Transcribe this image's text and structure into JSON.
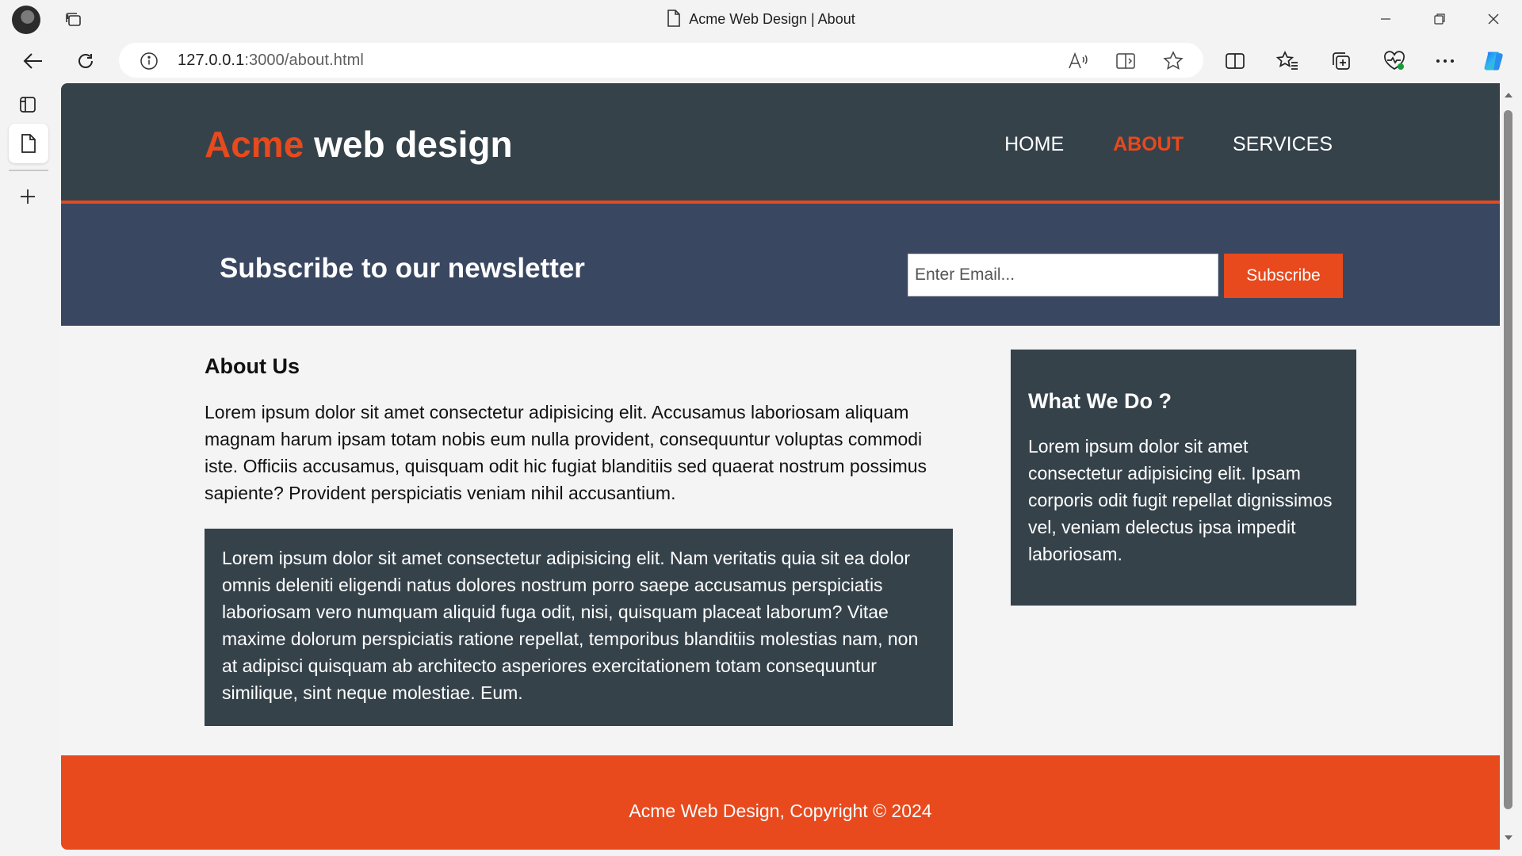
{
  "browser": {
    "tab_title": "Acme Web Design | About",
    "url_host": "127.0.0.1",
    "url_path": ":3000/about.html"
  },
  "site": {
    "brand_highlight": "Acme",
    "brand_rest": " web design",
    "nav": [
      {
        "label": "HOME",
        "current": false
      },
      {
        "label": "ABOUT",
        "current": true
      },
      {
        "label": "SERVICES",
        "current": false
      }
    ],
    "newsletter": {
      "heading": "Subscribe to our newsletter",
      "placeholder": "Enter Email...",
      "button_label": "Subscribe"
    },
    "main": {
      "heading": "About Us",
      "lead": "Lorem ipsum dolor sit amet consectetur adipisicing elit. Accusamus laboriosam aliquam magnam harum ipsam totam nobis eum nulla provident, consequuntur voluptas commodi iste. Officiis accusamus, quisquam odit hic fugiat blanditiis sed quaerat nostrum possimus sapiente? Provident perspiciatis veniam nihil accusantium.",
      "dark_box": "Lorem ipsum dolor sit amet consectetur adipisicing elit. Nam veritatis quia sit ea dolor omnis deleniti eligendi natus dolores nostrum porro saepe accusamus perspiciatis laboriosam vero numquam aliquid fuga odit, nisi, quisquam placeat laborum? Vitae maxime dolorum perspiciatis ratione repellat, temporibus blanditiis molestias nam, non at adipisci quisquam ab architecto asperiores exercitationem totam consequuntur similique, sint neque molestiae. Eum."
    },
    "aside": {
      "heading": "What We Do ?",
      "text": "Lorem ipsum dolor sit amet consectetur adipisicing elit. Ipsam corporis odit fugit repellat dignissimos vel, veniam delectus ipsa impedit laboriosam."
    },
    "footer": "Acme Web Design, Copyright © 2024"
  },
  "colors": {
    "brand_orange": "#e8491d",
    "header_dark": "#35424a",
    "newsletter_bg": "#3a4761"
  }
}
